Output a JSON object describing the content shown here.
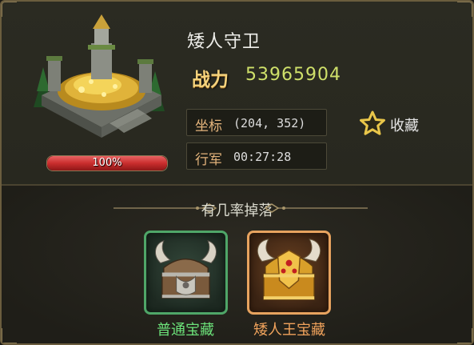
{
  "monster": {
    "name": "矮人守卫",
    "power_label": "战力",
    "power_value": "53965904",
    "hp_percent_text": "100%",
    "hp_fraction": 1.0,
    "coord_label": "坐标",
    "coord_value": "(204, 352)",
    "march_label": "行军",
    "march_value": "00:27:28"
  },
  "favorite": {
    "label": "收藏",
    "icon": "star-outline-icon"
  },
  "drops": {
    "title": "有几率掉落",
    "items": [
      {
        "name": "普通宝藏",
        "rarity_color": "#4fa668",
        "icon": "common-treasure-chest-icon"
      },
      {
        "name": "矮人王宝藏",
        "rarity_color": "#e7a35f",
        "icon": "dwarf-king-treasure-chest-icon"
      }
    ]
  },
  "colors": {
    "power_label": "#f4d27c",
    "power_value": "#cfe06a",
    "info_label": "#e4b47c",
    "hp_fill": "#c92d2d",
    "common_label": "#6ce27a",
    "king_label": "#f1a35c"
  }
}
